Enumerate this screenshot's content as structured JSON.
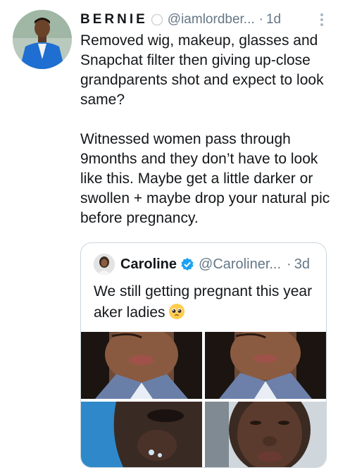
{
  "tweet": {
    "author_name": "BERNIE",
    "author_handle": "@iamlordber...",
    "separator": "·",
    "timestamp": "1d",
    "text": "Removed wig, makeup, glasses and Snapchat filter then giving up-close grandparents shot and expect to look same?\n\nWitnessed women pass through 9months and they don’t have to look like this. Maybe get a little darker or swollen + maybe drop your natural pic before pregnancy."
  },
  "quoted_tweet": {
    "author_name": "Caroline",
    "author_handle": "@Caroliner...",
    "separator": "·",
    "timestamp": "3d",
    "text": "We still getting pregnant this year aker ladies",
    "emoji": "pleading-face-emoji",
    "media_count": 4
  },
  "colors": {
    "text": "#14171a",
    "secondary": "#657786",
    "border": "#ccd6dd",
    "verified": "#1da1f2",
    "avatar_jacket": "#1e6fd1"
  },
  "icons": [
    "status-ring-icon",
    "more-options-icon",
    "verified-badge-icon",
    "pleading-face-emoji"
  ]
}
